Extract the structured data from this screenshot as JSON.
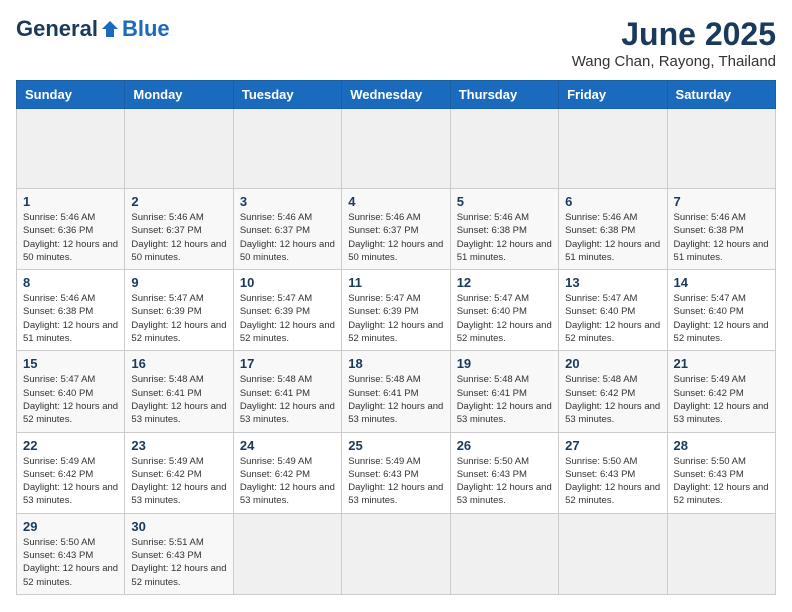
{
  "header": {
    "logo_general": "General",
    "logo_blue": "Blue",
    "month_year": "June 2025",
    "location": "Wang Chan, Rayong, Thailand"
  },
  "calendar": {
    "days_of_week": [
      "Sunday",
      "Monday",
      "Tuesday",
      "Wednesday",
      "Thursday",
      "Friday",
      "Saturday"
    ],
    "weeks": [
      [
        {
          "day": "",
          "empty": true
        },
        {
          "day": "",
          "empty": true
        },
        {
          "day": "",
          "empty": true
        },
        {
          "day": "",
          "empty": true
        },
        {
          "day": "",
          "empty": true
        },
        {
          "day": "",
          "empty": true
        },
        {
          "day": "",
          "empty": true
        }
      ],
      [
        {
          "day": "1",
          "sunrise": "5:46 AM",
          "sunset": "6:36 PM",
          "daylight": "12 hours and 50 minutes."
        },
        {
          "day": "2",
          "sunrise": "5:46 AM",
          "sunset": "6:37 PM",
          "daylight": "12 hours and 50 minutes."
        },
        {
          "day": "3",
          "sunrise": "5:46 AM",
          "sunset": "6:37 PM",
          "daylight": "12 hours and 50 minutes."
        },
        {
          "day": "4",
          "sunrise": "5:46 AM",
          "sunset": "6:37 PM",
          "daylight": "12 hours and 50 minutes."
        },
        {
          "day": "5",
          "sunrise": "5:46 AM",
          "sunset": "6:38 PM",
          "daylight": "12 hours and 51 minutes."
        },
        {
          "day": "6",
          "sunrise": "5:46 AM",
          "sunset": "6:38 PM",
          "daylight": "12 hours and 51 minutes."
        },
        {
          "day": "7",
          "sunrise": "5:46 AM",
          "sunset": "6:38 PM",
          "daylight": "12 hours and 51 minutes."
        }
      ],
      [
        {
          "day": "8",
          "sunrise": "5:46 AM",
          "sunset": "6:38 PM",
          "daylight": "12 hours and 51 minutes."
        },
        {
          "day": "9",
          "sunrise": "5:47 AM",
          "sunset": "6:39 PM",
          "daylight": "12 hours and 52 minutes."
        },
        {
          "day": "10",
          "sunrise": "5:47 AM",
          "sunset": "6:39 PM",
          "daylight": "12 hours and 52 minutes."
        },
        {
          "day": "11",
          "sunrise": "5:47 AM",
          "sunset": "6:39 PM",
          "daylight": "12 hours and 52 minutes."
        },
        {
          "day": "12",
          "sunrise": "5:47 AM",
          "sunset": "6:40 PM",
          "daylight": "12 hours and 52 minutes."
        },
        {
          "day": "13",
          "sunrise": "5:47 AM",
          "sunset": "6:40 PM",
          "daylight": "12 hours and 52 minutes."
        },
        {
          "day": "14",
          "sunrise": "5:47 AM",
          "sunset": "6:40 PM",
          "daylight": "12 hours and 52 minutes."
        }
      ],
      [
        {
          "day": "15",
          "sunrise": "5:47 AM",
          "sunset": "6:40 PM",
          "daylight": "12 hours and 52 minutes."
        },
        {
          "day": "16",
          "sunrise": "5:48 AM",
          "sunset": "6:41 PM",
          "daylight": "12 hours and 53 minutes."
        },
        {
          "day": "17",
          "sunrise": "5:48 AM",
          "sunset": "6:41 PM",
          "daylight": "12 hours and 53 minutes."
        },
        {
          "day": "18",
          "sunrise": "5:48 AM",
          "sunset": "6:41 PM",
          "daylight": "12 hours and 53 minutes."
        },
        {
          "day": "19",
          "sunrise": "5:48 AM",
          "sunset": "6:41 PM",
          "daylight": "12 hours and 53 minutes."
        },
        {
          "day": "20",
          "sunrise": "5:48 AM",
          "sunset": "6:42 PM",
          "daylight": "12 hours and 53 minutes."
        },
        {
          "day": "21",
          "sunrise": "5:49 AM",
          "sunset": "6:42 PM",
          "daylight": "12 hours and 53 minutes."
        }
      ],
      [
        {
          "day": "22",
          "sunrise": "5:49 AM",
          "sunset": "6:42 PM",
          "daylight": "12 hours and 53 minutes."
        },
        {
          "day": "23",
          "sunrise": "5:49 AM",
          "sunset": "6:42 PM",
          "daylight": "12 hours and 53 minutes."
        },
        {
          "day": "24",
          "sunrise": "5:49 AM",
          "sunset": "6:42 PM",
          "daylight": "12 hours and 53 minutes."
        },
        {
          "day": "25",
          "sunrise": "5:49 AM",
          "sunset": "6:43 PM",
          "daylight": "12 hours and 53 minutes."
        },
        {
          "day": "26",
          "sunrise": "5:50 AM",
          "sunset": "6:43 PM",
          "daylight": "12 hours and 53 minutes."
        },
        {
          "day": "27",
          "sunrise": "5:50 AM",
          "sunset": "6:43 PM",
          "daylight": "12 hours and 52 minutes."
        },
        {
          "day": "28",
          "sunrise": "5:50 AM",
          "sunset": "6:43 PM",
          "daylight": "12 hours and 52 minutes."
        }
      ],
      [
        {
          "day": "29",
          "sunrise": "5:50 AM",
          "sunset": "6:43 PM",
          "daylight": "12 hours and 52 minutes."
        },
        {
          "day": "30",
          "sunrise": "5:51 AM",
          "sunset": "6:43 PM",
          "daylight": "12 hours and 52 minutes."
        },
        {
          "day": "",
          "empty": true
        },
        {
          "day": "",
          "empty": true
        },
        {
          "day": "",
          "empty": true
        },
        {
          "day": "",
          "empty": true
        },
        {
          "day": "",
          "empty": true
        }
      ]
    ]
  }
}
